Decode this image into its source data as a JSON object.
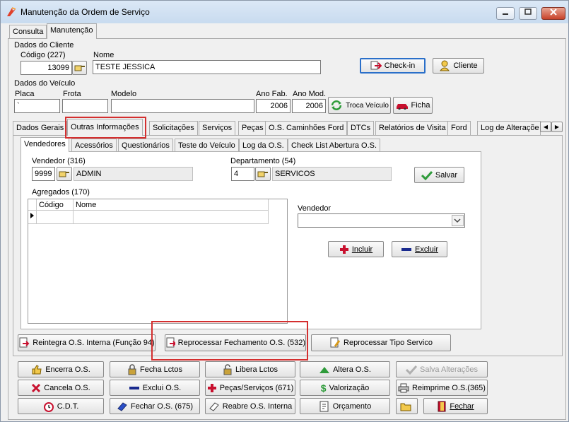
{
  "window": {
    "title": "Manutenção da Ordem de Serviço"
  },
  "top_tabs": [
    "Consulta",
    "Manutenção"
  ],
  "cliente": {
    "section": "Dados do Cliente",
    "codigo_label": "Código (227)",
    "codigo": "13099",
    "nome_label": "Nome",
    "nome": "TESTE JESSICA",
    "checkin": "Check-in",
    "cliente_btn": "Cliente"
  },
  "veiculo": {
    "section": "Dados do Veículo",
    "placa_label": "Placa",
    "placa": "`",
    "frota_label": "Frota",
    "modelo_label": "Modelo",
    "ano_fab_label": "Ano Fab.",
    "ano_fab": "2006",
    "ano_mod_label": "Ano Mod.",
    "ano_mod": "2006",
    "troca": "Troca Veículo",
    "ficha": "Ficha"
  },
  "main_tabs": [
    "Dados Gerais",
    "Outras Informações",
    "Solicitações",
    "Serviços",
    "Peças",
    "O.S. Caminhões Ford",
    "DTCs",
    "Relatórios de Visita",
    "Ford",
    "Log de Alteraçõe"
  ],
  "sub_tabs": [
    "Vendedores",
    "Acessórios",
    "Questionários",
    "Teste do Veículo",
    "Log da O.S.",
    "Check List Abertura O.S."
  ],
  "vendedores": {
    "vendedor_label": "Vendedor (316)",
    "vendedor_code": "9999",
    "vendedor_name": "ADMIN",
    "depto_label": "Departamento (54)",
    "depto_code": "4",
    "depto_name": "SERVICOS",
    "salvar": "Salvar"
  },
  "agregados": {
    "label": "Agregados (170)",
    "columns": [
      "Código",
      "Nome"
    ],
    "vendedor_label": "Vendedor",
    "vendedor_value": "",
    "incluir": "Incluir",
    "excluir": "Excluir"
  },
  "actions": {
    "reintegra": "Reintegra O.S. Interna (Função 94)",
    "reprocessar_fech": "Reprocessar Fechamento O.S. (532)",
    "reprocessar_tipo": "Reprocessar Tipo Servico"
  },
  "bottom_buttons": [
    [
      "Encerra O.S.",
      "Fecha Lctos",
      "Libera Lctos",
      "Altera O.S.",
      "Salva Alterações"
    ],
    [
      "Cancela O.S.",
      "Exclui O.S.",
      "Peças/Serviços (671)",
      "Valorização",
      "Reimprime O.S.(365)"
    ],
    [
      "C.D.T.",
      "Fechar O.S. (675)",
      "Reabre O.S. Interna",
      "Orçamento",
      "",
      "Fechar"
    ]
  ],
  "colors": {
    "highlight": "#d42f2f",
    "accent_blue": "#2a6fc9",
    "red_icon": "#c8102e",
    "green_icon": "#2e9b3a"
  }
}
